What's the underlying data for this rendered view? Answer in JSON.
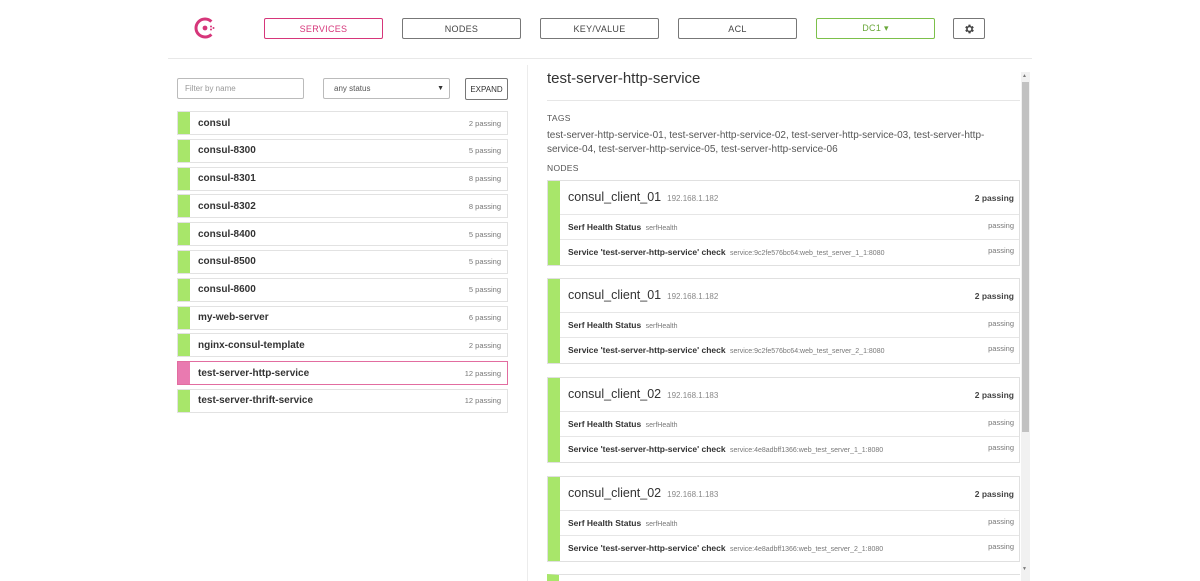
{
  "header": {
    "nav": [
      "SERVICES",
      "NODES",
      "KEY/VALUE",
      "ACL"
    ],
    "datacenter": "DC1 ▾",
    "colors": {
      "accent": "#d6367a",
      "passing": "#a8e66a",
      "dc": "#7cc04a"
    }
  },
  "filters": {
    "filter_placeholder": "Filter by name",
    "status_value": "any status",
    "expand_label": "EXPAND"
  },
  "services": [
    {
      "name": "consul",
      "status": "2 passing"
    },
    {
      "name": "consul-8300",
      "status": "5 passing"
    },
    {
      "name": "consul-8301",
      "status": "8 passing"
    },
    {
      "name": "consul-8302",
      "status": "8 passing"
    },
    {
      "name": "consul-8400",
      "status": "5 passing"
    },
    {
      "name": "consul-8500",
      "status": "5 passing"
    },
    {
      "name": "consul-8600",
      "status": "5 passing"
    },
    {
      "name": "my-web-server",
      "status": "6 passing"
    },
    {
      "name": "nginx-consul-template",
      "status": "2 passing"
    },
    {
      "name": "test-server-http-service",
      "status": "12 passing"
    },
    {
      "name": "test-server-thrift-service",
      "status": "12 passing"
    }
  ],
  "detail": {
    "title": "test-server-http-service",
    "tags_label": "TAGS",
    "tags": "test-server-http-service-01, test-server-http-service-02, test-server-http-service-03, test-server-http-service-04, test-server-http-service-05, test-server-http-service-06",
    "nodes_label": "NODES",
    "nodes": [
      {
        "name": "consul_client_01",
        "address": "192.168.1.182",
        "status": "2 passing",
        "checks": [
          {
            "name": "Serf Health Status",
            "id": "serfHealth",
            "status": "passing"
          },
          {
            "name": "Service 'test-server-http-service' check",
            "id": "service:9c2fe576bc64:web_test_server_1_1:8080",
            "status": "passing"
          }
        ]
      },
      {
        "name": "consul_client_01",
        "address": "192.168.1.182",
        "status": "2 passing",
        "checks": [
          {
            "name": "Serf Health Status",
            "id": "serfHealth",
            "status": "passing"
          },
          {
            "name": "Service 'test-server-http-service' check",
            "id": "service:9c2fe576bc64:web_test_server_2_1:8080",
            "status": "passing"
          }
        ]
      },
      {
        "name": "consul_client_02",
        "address": "192.168.1.183",
        "status": "2 passing",
        "checks": [
          {
            "name": "Serf Health Status",
            "id": "serfHealth",
            "status": "passing"
          },
          {
            "name": "Service 'test-server-http-service' check",
            "id": "service:4e8adbff1366:web_test_server_1_1:8080",
            "status": "passing"
          }
        ]
      },
      {
        "name": "consul_client_02",
        "address": "192.168.1.183",
        "status": "2 passing",
        "checks": [
          {
            "name": "Serf Health Status",
            "id": "serfHealth",
            "status": "passing"
          },
          {
            "name": "Service 'test-server-http-service' check",
            "id": "service:4e8adbff1366:web_test_server_2_1:8080",
            "status": "passing"
          }
        ]
      }
    ]
  }
}
